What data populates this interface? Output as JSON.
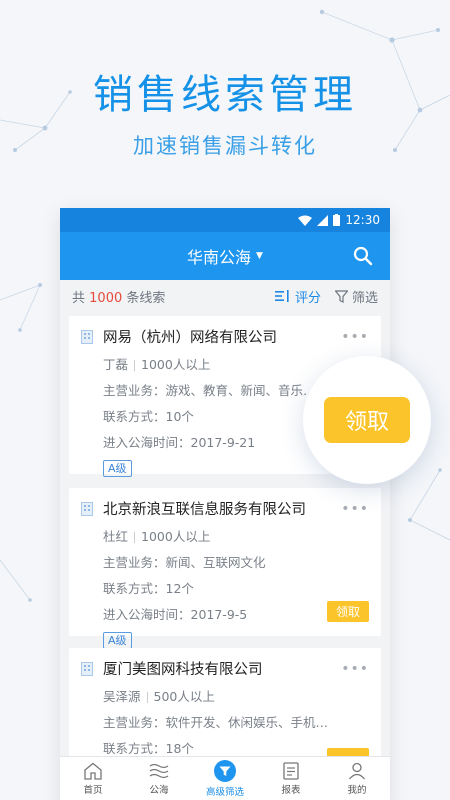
{
  "promo": {
    "headline": "销售线索管理",
    "subline": "加速销售漏斗转化"
  },
  "statusbar": {
    "time": "12:30"
  },
  "appbar": {
    "title": "华南公海"
  },
  "filterbar": {
    "prefix": "共",
    "count": "1000",
    "suffix": "条线索",
    "sort_label": "评分",
    "filter_label": "筛选"
  },
  "cards": [
    {
      "company": "网易（杭州）网络有限公司",
      "contact": "丁磊",
      "size": "1000人以上",
      "business": "主营业务：游戏、教育、新闻、音乐…",
      "contacts": "联系方式：10个",
      "entered": "进入公海时间：2017-9-21",
      "grade": "A级"
    },
    {
      "company": "北京新浪互联信息服务有限公司",
      "contact": "杜红",
      "size": "1000人以上",
      "business": "主营业务：新闻、互联网文化",
      "contacts": "联系方式：12个",
      "entered": "进入公海时间：2017-9-5",
      "grade": "A级",
      "claim": "领取"
    },
    {
      "company": "厦门美图网科技有限公司",
      "contact": "吴泽源",
      "size": "500人以上",
      "business": "主营业务：软件开发、休闲娱乐、手机…",
      "contacts": "联系方式：18个"
    }
  ],
  "bubble": {
    "claim": "领取"
  },
  "tabs": [
    {
      "label": "首页"
    },
    {
      "label": "公海"
    },
    {
      "label": "高级筛选"
    },
    {
      "label": "报表"
    },
    {
      "label": "我的"
    }
  ],
  "colors": {
    "primary": "#1e95ef",
    "headline": "#1592e8",
    "accent_yellow": "#fcc42b",
    "count_red": "#e64a3c"
  }
}
